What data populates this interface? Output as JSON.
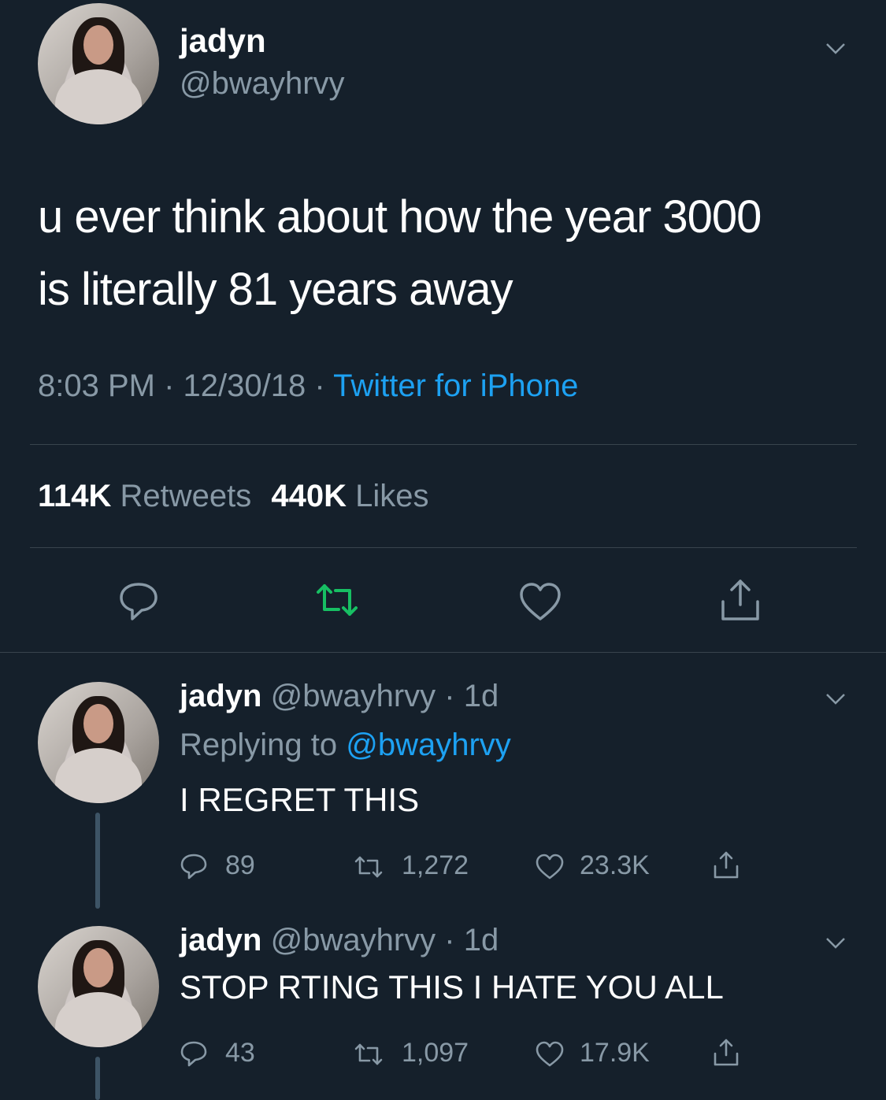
{
  "main_tweet": {
    "name": "jadyn",
    "handle": "@bwayhrvy",
    "text_line1": "u ever think about how the year 3000",
    "text_line2": "is literally 81 years away",
    "time": "8:03 PM",
    "date": "12/30/18",
    "source": "Twitter for iPhone",
    "retweets_count": "114K",
    "retweets_label": "Retweets",
    "likes_count": "440K",
    "likes_label": "Likes"
  },
  "reply1": {
    "name": "jadyn",
    "handle": "@bwayhrvy",
    "age": "1d",
    "replying_prefix": "Replying to",
    "replying_handle": "@bwayhrvy",
    "text": "I REGRET THIS",
    "replies": "89",
    "retweets": "1,272",
    "likes": "23.3K"
  },
  "reply2": {
    "name": "jadyn",
    "handle": "@bwayhrvy",
    "age": "1d",
    "text": "STOP RTING THIS I HATE YOU ALL",
    "replies": "43",
    "retweets": "1,097",
    "likes": "17.9K"
  },
  "colors": {
    "background": "#15202b",
    "link": "#1da1f2",
    "retweet_active": "#17bf63",
    "muted": "#8899a6"
  },
  "icons": [
    "reply-icon",
    "retweet-icon",
    "heart-icon",
    "share-icon",
    "chevron-down-icon"
  ],
  "separator": "·"
}
